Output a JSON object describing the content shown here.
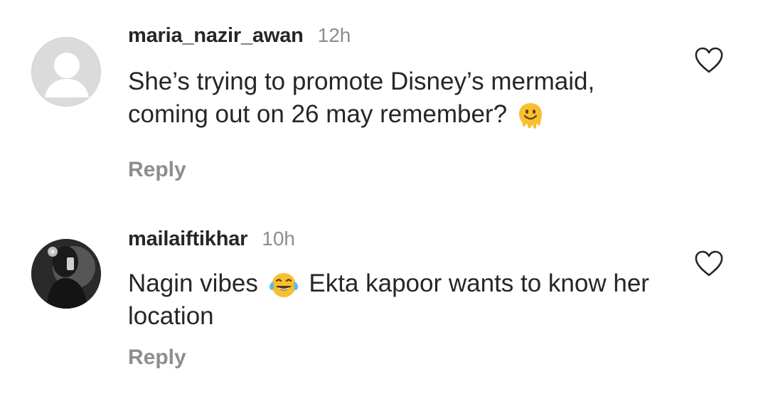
{
  "comments": [
    {
      "username": "maria_nazir_awan",
      "time": "12h",
      "text_before_emoji": "She’s trying to promote Disney’s mermaid, coming out on 26 may remember?",
      "emoji": "melting-face",
      "text_after_emoji": "",
      "reply_label": "Reply",
      "avatar": "default-avatar"
    },
    {
      "username": "mailaiftikhar",
      "time": "10h",
      "text_before_emoji": "Nagin vibes",
      "emoji": "tears-of-joy",
      "text_after_emoji": "Ekta kapoor wants to know her location",
      "reply_label": "Reply",
      "avatar": "photo-avatar"
    }
  ],
  "colors": {
    "text": "#262626",
    "secondary": "#8e8e8e",
    "avatar_default": "#dbdbdb",
    "emoji_yellow": "#f7c02c"
  },
  "icons": {
    "like": "heart-outline-icon"
  }
}
